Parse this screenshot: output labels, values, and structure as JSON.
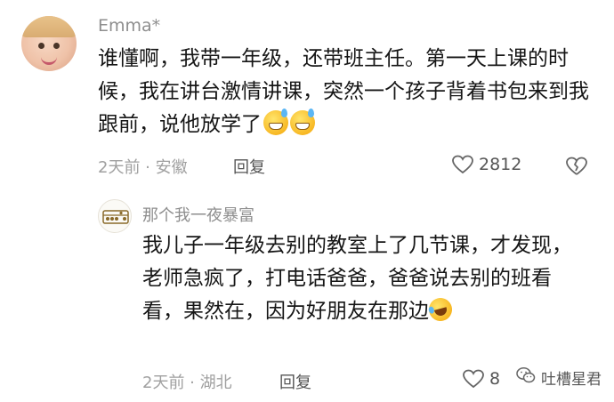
{
  "comment": {
    "username": "Emma*",
    "text": "谁懂啊，我带一年级，还带班主任。第一天上课的时候，我在讲台激情讲课，突然一个孩子背着书包来到我跟前，说他放学了",
    "time_location": "2天前 · 安徽",
    "reply_label": "回复",
    "like_count": "2812"
  },
  "reply": {
    "username": "那个我一夜暴富",
    "text": "我儿子一年级去别的教室上了几节课，才发现，老师急疯了，打电话爸爸，爸爸说去别的班看看，果然在，因为好朋友在那边",
    "time_location": "2天前 · 湖北",
    "reply_label": "回复",
    "like_count": "8"
  },
  "watermark": {
    "label": "吐槽星君"
  },
  "icons": {
    "heart": "heart-outline-icon",
    "dislike": "broken-heart-icon",
    "wechat": "wechat-icon"
  },
  "colors": {
    "meta": "#a0a0a0",
    "text": "#161616"
  }
}
